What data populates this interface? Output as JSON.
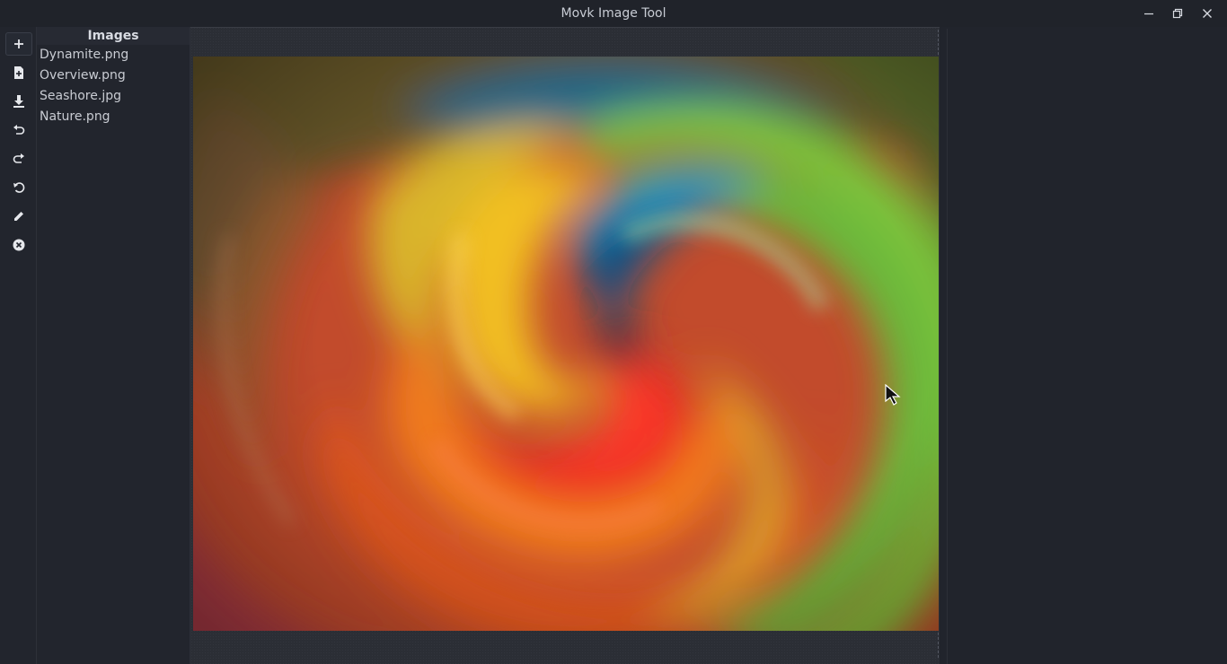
{
  "window": {
    "title": "Movk Image Tool"
  },
  "window_controls": [
    "minimize-icon",
    "restore-icon",
    "close-icon"
  ],
  "toolbar": {
    "tools": [
      {
        "icon": "add-icon"
      },
      {
        "icon": "new-file-icon"
      },
      {
        "icon": "download-icon"
      },
      {
        "icon": "undo-icon"
      },
      {
        "icon": "redo-icon"
      },
      {
        "icon": "reset-icon"
      },
      {
        "icon": "edit-icon"
      },
      {
        "icon": "close-circle-icon"
      }
    ]
  },
  "images_panel": {
    "header": "Images",
    "files": [
      "Dynamite.png",
      "Overview.png",
      "Seashore.jpg",
      "Nature.png"
    ]
  },
  "canvas": {
    "image_description_icon": "swirl-image"
  },
  "colors": {
    "background": "#21242c",
    "text": "#c9ccd3"
  }
}
